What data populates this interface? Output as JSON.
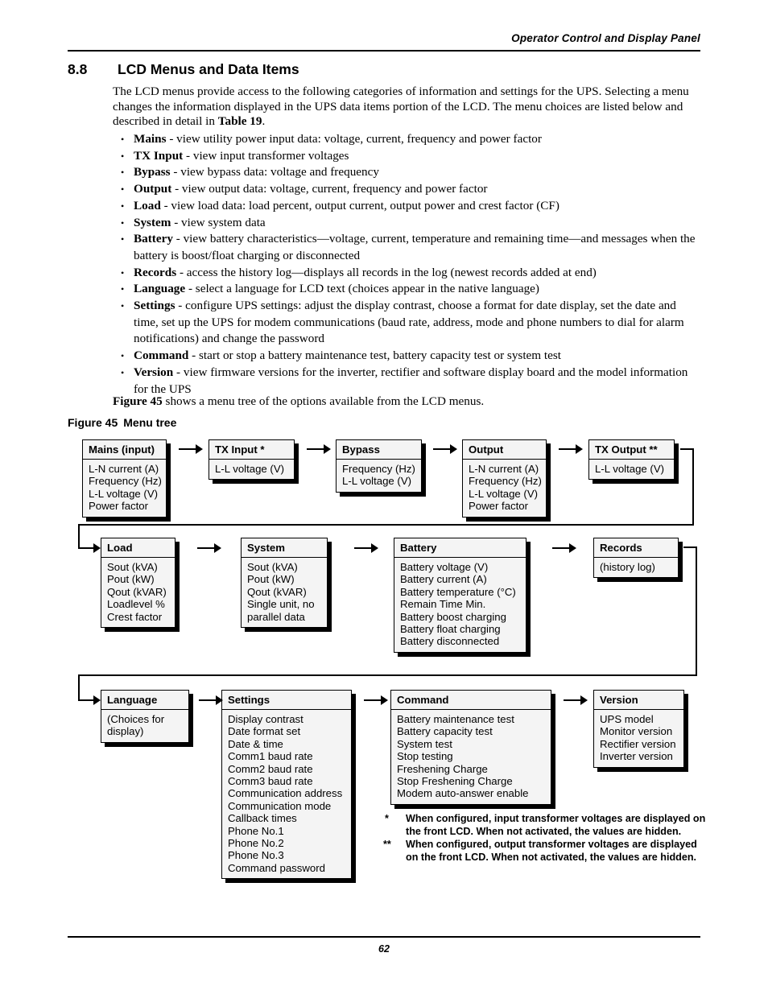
{
  "header": {
    "running_title": "Operator Control and Display Panel"
  },
  "section": {
    "number": "8.8",
    "title": "LCD Menus and Data Items"
  },
  "intro": {
    "line1": "The LCD menus provide access to the following categories of information and settings for the UPS.",
    "line2": "Selecting a menu changes the information displayed in the UPS data items portion of the LCD. The",
    "line3_pre": "menu choices are listed below and described in detail in ",
    "line3_bold": "Table 19",
    "line3_post": "."
  },
  "bullets": [
    {
      "term": "Mains",
      "desc": " - view utility power input data: voltage, current, frequency and power factor"
    },
    {
      "term": "TX Input",
      "desc": " - view input transformer voltages"
    },
    {
      "term": "Bypass",
      "desc": " - view bypass data: voltage and frequency"
    },
    {
      "term": "Output",
      "desc": " - view output data: voltage, current, frequency and power factor"
    },
    {
      "term": "Load",
      "desc": " - view load data: load percent, output current, output power and crest factor (CF)"
    },
    {
      "term": "System",
      "desc": " - view system data"
    },
    {
      "term": "Battery",
      "desc": " - view battery characteristics—voltage, current, temperature and remaining time—and messages when the battery is boost/float charging or disconnected"
    },
    {
      "term": "Records",
      "desc": " - access the history log—displays all records in the log (newest records added at end)"
    },
    {
      "term": "Language",
      "desc": " - select a language for LCD text (choices appear in the native language)"
    },
    {
      "term": "Settings",
      "desc": " - configure UPS settings: adjust the display contrast, choose a format for date display, set the date and time, set up the UPS for modem communications (baud rate, address, mode and phone numbers to dial for alarm notifications) and change the password"
    },
    {
      "term": "Command",
      "desc": " - start or stop a battery maintenance test, battery capacity test or system test"
    },
    {
      "term": "Version",
      "desc": " - view firmware versions for the inverter, rectifier and software display board and the model information for the UPS"
    }
  ],
  "figure_ref": {
    "bold": "Figure 45",
    "rest": " shows a menu tree of the options available from the LCD menus."
  },
  "figure": {
    "caption_label": "Figure 45",
    "caption_text": "Menu tree"
  },
  "menu_tree": {
    "boxes": [
      {
        "id": "mains",
        "title": "Mains (input)",
        "items": [
          "L-N current (A)",
          "Frequency (Hz)",
          "L-L voltage (V)",
          "Power factor"
        ]
      },
      {
        "id": "tx-input",
        "title": "TX Input *",
        "items": [
          "L-L voltage (V)"
        ]
      },
      {
        "id": "bypass",
        "title": "Bypass",
        "items": [
          "Frequency (Hz)",
          "L-L voltage (V)"
        ]
      },
      {
        "id": "output",
        "title": "Output",
        "items": [
          "L-N current (A)",
          "Frequency (Hz)",
          "L-L voltage (V)",
          "Power factor"
        ]
      },
      {
        "id": "tx-output",
        "title": "TX Output **",
        "items": [
          "L-L voltage (V)"
        ]
      },
      {
        "id": "load",
        "title": "Load",
        "items": [
          "Sout (kVA)",
          "Pout (kW)",
          "Qout (kVAR)",
          "Loadlevel %",
          "Crest factor"
        ]
      },
      {
        "id": "system",
        "title": "System",
        "items": [
          "Sout (kVA)",
          "Pout (kW)",
          "Qout (kVAR)",
          "Single unit, no",
          "parallel data"
        ]
      },
      {
        "id": "battery",
        "title": "Battery",
        "items": [
          "Battery voltage (V)",
          "Battery current (A)",
          "Battery temperature (°C)",
          "Remain Time Min.",
          "Battery boost charging",
          "Battery float charging",
          "Battery disconnected"
        ]
      },
      {
        "id": "records",
        "title": "Records",
        "items": [
          "(history log)"
        ]
      },
      {
        "id": "language",
        "title": "Language",
        "items": [
          "(Choices for",
          "display)"
        ]
      },
      {
        "id": "settings",
        "title": "Settings",
        "items": [
          "Display contrast",
          "Date format set",
          "Date & time",
          "Comm1 baud rate",
          "Comm2 baud rate",
          "Comm3 baud rate",
          "Communication address",
          "Communication mode",
          "Callback times",
          "Phone No.1",
          "Phone No.2",
          "Phone No.3",
          "Command password"
        ]
      },
      {
        "id": "command",
        "title": "Command",
        "items": [
          "Battery maintenance test",
          "Battery capacity test",
          "System test",
          "Stop testing",
          "Freshening Charge",
          "Stop Freshening Charge",
          "Modem auto-answer enable"
        ]
      },
      {
        "id": "version",
        "title": "Version",
        "items": [
          "UPS model",
          "Monitor version",
          "Rectifier version",
          "Inverter version"
        ]
      }
    ]
  },
  "footnotes": [
    {
      "mark": "*",
      "text": "When configured, input transformer voltages are displayed on the front LCD. When not activated, the values are hidden."
    },
    {
      "mark": "**",
      "text": "When configured, output transformer voltages are displayed on the front LCD. When not activated, the values are hidden."
    }
  ],
  "footer": {
    "page_number": "62"
  }
}
